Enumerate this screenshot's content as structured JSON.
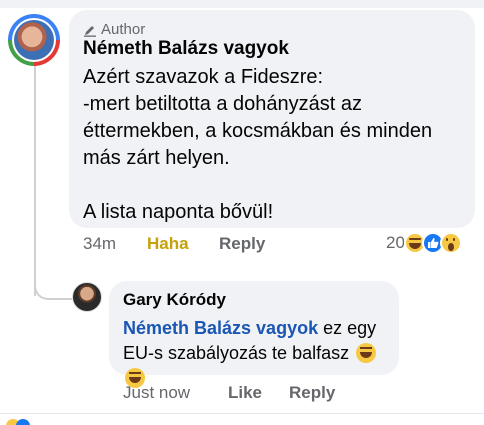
{
  "main_comment": {
    "author_badge": "Author",
    "author_name": "Németh Balázs vagyok",
    "text": "Azért szavazok a Fideszre:\n-mert betiltotta a dohányzást az éttermekben, a kocsmákban és minden más zárt helyen.\n\nA lista naponta bővül!",
    "time": "34m",
    "reaction_action": "Haha",
    "reply_label": "Reply",
    "reaction_count": "20",
    "reaction_icons": [
      "haha-emoji-icon",
      "like-emoji-icon",
      "wow-emoji-icon"
    ]
  },
  "reply_comment": {
    "author_name": "Gary Kóródy",
    "mention": "Németh Balázs vagyok",
    "text": " ez egy EU-s szabályozás te balfasz ",
    "time": "Just now",
    "like_label": "Like",
    "reply_label": "Reply"
  },
  "colors": {
    "bubble": "#f0f2f5",
    "haha_accent": "#c5a10a",
    "mention": "#1a56b3",
    "meta_gray": "#65676b"
  }
}
